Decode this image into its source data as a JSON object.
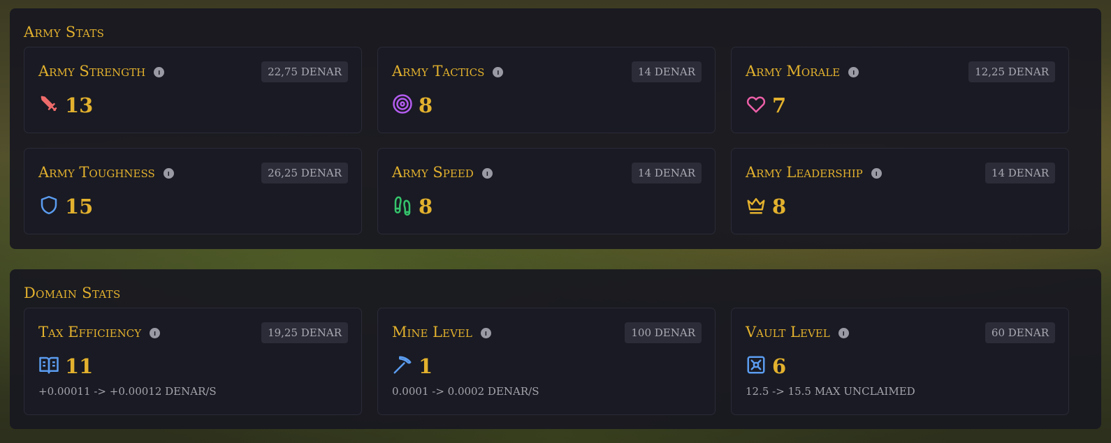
{
  "army": {
    "title": "Army Stats",
    "cards": [
      {
        "title": "Army Strength",
        "cost": "22,75 DENAR",
        "value": "13",
        "icon": "sword-icon"
      },
      {
        "title": "Army Tactics",
        "cost": "14 DENAR",
        "value": "8",
        "icon": "target-icon"
      },
      {
        "title": "Army Morale",
        "cost": "12,25 DENAR",
        "value": "7",
        "icon": "heart-icon"
      },
      {
        "title": "Army Toughness",
        "cost": "26,25 DENAR",
        "value": "15",
        "icon": "shield-icon"
      },
      {
        "title": "Army Speed",
        "cost": "14 DENAR",
        "value": "8",
        "icon": "footprints-icon"
      },
      {
        "title": "Army Leadership",
        "cost": "14 DENAR",
        "value": "8",
        "icon": "crown-icon"
      }
    ]
  },
  "domain": {
    "title": "Domain Stats",
    "cards": [
      {
        "title": "Tax Efficiency",
        "cost": "19,25 DENAR",
        "value": "11",
        "icon": "book-icon",
        "sub": "+0.00011 -> +0.00012 DENAR/S"
      },
      {
        "title": "Mine Level",
        "cost": "100 DENAR",
        "value": "1",
        "icon": "pickaxe-icon",
        "sub": "0.0001 -> 0.0002 DENAR/S"
      },
      {
        "title": "Vault Level",
        "cost": "60 DENAR",
        "value": "6",
        "icon": "vault-icon",
        "sub": "12.5 -> 15.5 MAX UNCLAIMED"
      }
    ]
  },
  "info_glyph": "i",
  "colors": {
    "accent": "#e3b12e",
    "sword": "#ef6b6b",
    "target": "#b45cf0",
    "heart": "#ec5fa8",
    "shield": "#5b9cf0",
    "footprints": "#35c46c",
    "crown": "#e3b12e",
    "book": "#5b9cf0",
    "pickaxe": "#5b9cf0",
    "vault": "#5b9cf0"
  }
}
